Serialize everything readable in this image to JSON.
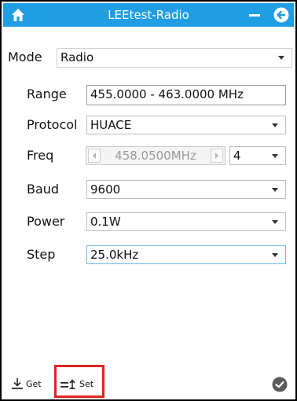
{
  "window": {
    "title": "LEEtest-Radio",
    "accent_color": "#1f9ee3",
    "icons": [
      "home-icon",
      "minimize-icon",
      "back-icon"
    ]
  },
  "mode": {
    "label": "Mode",
    "value": "Radio"
  },
  "form": {
    "range": {
      "label": "Range",
      "value": "455.0000 - 463.0000 MHz"
    },
    "protocol": {
      "label": "Protocol",
      "value": "HUACE"
    },
    "freq": {
      "label": "Freq",
      "value": "458.0500MHz",
      "channel": "4"
    },
    "baud": {
      "label": "Baud",
      "value": "9600"
    },
    "power": {
      "label": "Power",
      "value": "0.1W"
    },
    "step": {
      "label": "Step",
      "value": "25.0kHz"
    }
  },
  "toolbar": {
    "get_label": "Get",
    "set_label": "Set",
    "highlight_color": "#e0261f"
  }
}
